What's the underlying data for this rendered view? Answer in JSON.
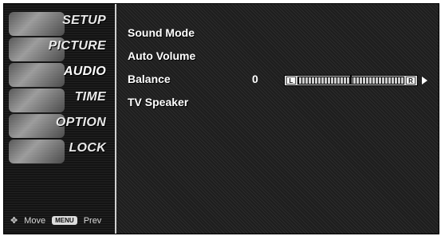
{
  "left_menu": {
    "items": [
      {
        "label": "SETUP",
        "active": false
      },
      {
        "label": "PICTURE",
        "active": false
      },
      {
        "label": "AUDIO",
        "active": true
      },
      {
        "label": "TIME",
        "active": false
      },
      {
        "label": "OPTION",
        "active": false
      },
      {
        "label": "LOCK",
        "active": false
      }
    ],
    "bottom_hint": {
      "move_label": "Move",
      "menu_key_label": "MENU",
      "prev_label": "Prev"
    }
  },
  "audio_panel": {
    "options": [
      {
        "label": "Sound Mode"
      },
      {
        "label": "Auto Volume"
      },
      {
        "label": "Balance"
      },
      {
        "label": "TV Speaker"
      }
    ],
    "balance": {
      "value": "0",
      "left_cap": "L",
      "right_cap": "R",
      "position_fraction": 0.5
    }
  }
}
